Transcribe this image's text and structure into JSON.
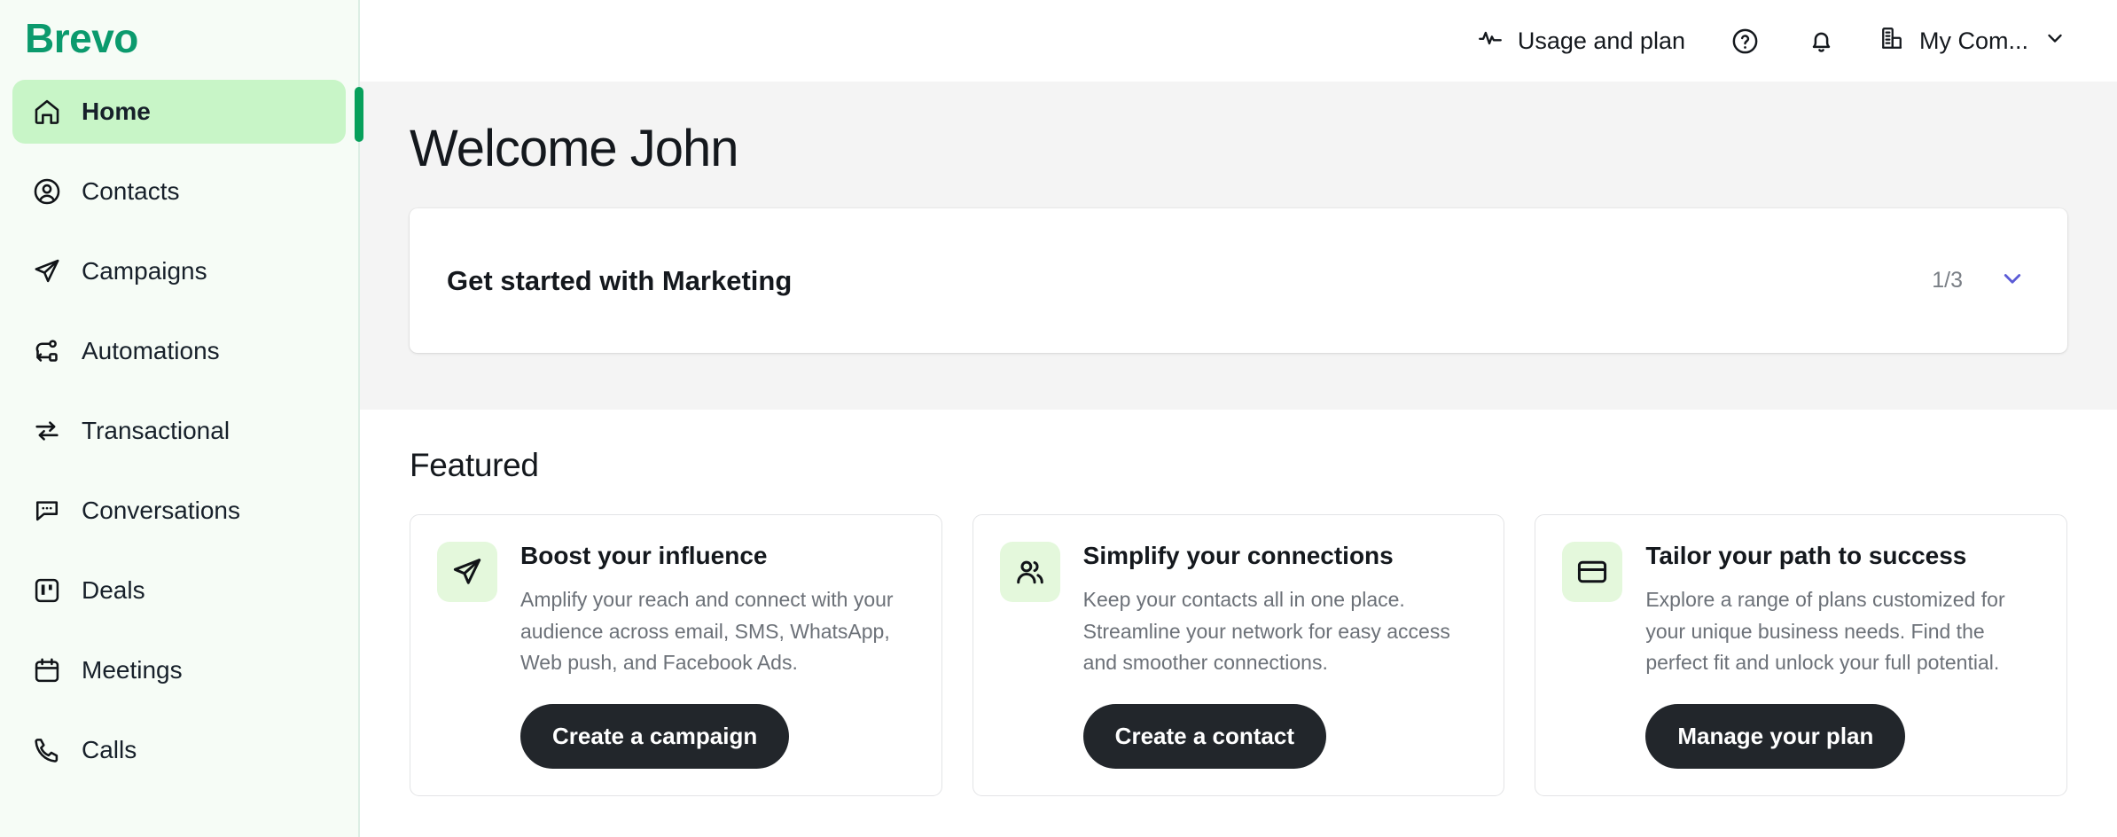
{
  "brand": {
    "logo_text": "Brevo",
    "logo_color": "#0B9A6D",
    "accent_green": "#07A05B",
    "active_pill": "#C8F5C7",
    "tile_green": "#E4F8DC",
    "chevron_purple": "#5B5BD6"
  },
  "sidebar": {
    "items": [
      {
        "label": "Home",
        "icon": "home-icon",
        "active": true
      },
      {
        "label": "Contacts",
        "icon": "user-circle-icon",
        "active": false
      },
      {
        "label": "Campaigns",
        "icon": "paper-plane-icon",
        "active": false
      },
      {
        "label": "Automations",
        "icon": "automation-icon",
        "active": false
      },
      {
        "label": "Transactional",
        "icon": "transfer-icon",
        "active": false
      },
      {
        "label": "Conversations",
        "icon": "chat-bubble-icon",
        "active": false
      },
      {
        "label": "Deals",
        "icon": "board-icon",
        "active": false
      },
      {
        "label": "Meetings",
        "icon": "calendar-icon",
        "active": false
      },
      {
        "label": "Calls",
        "icon": "phone-icon",
        "active": false
      }
    ]
  },
  "topbar": {
    "usage_label": "Usage and plan",
    "usage_icon": "pulse-icon",
    "help_icon": "help-circle-icon",
    "notifications_icon": "bell-icon",
    "company_icon": "building-icon",
    "company_label": "My Com...",
    "company_chevron": "chevron-down-icon"
  },
  "main": {
    "welcome_title": "Welcome John",
    "get_started": {
      "title": "Get started with Marketing",
      "progress": "1/3",
      "expand_icon": "chevron-down-icon"
    },
    "featured_title": "Featured",
    "featured_cards": [
      {
        "icon": "paper-plane-icon",
        "heading": "Boost your influence",
        "description": "Amplify your reach and connect with your audience across email, SMS, WhatsApp, Web push, and Facebook Ads.",
        "button": "Create a campaign"
      },
      {
        "icon": "users-icon",
        "heading": "Simplify your connections",
        "description": "Keep your contacts all in one place. Streamline your network for easy access and smoother connections.",
        "button": "Create a contact"
      },
      {
        "icon": "credit-card-icon",
        "heading": "Tailor your path to success",
        "description": "Explore a range of plans customized for your unique business needs. Find the perfect fit and unlock your full potential.",
        "button": "Manage your plan"
      }
    ]
  }
}
